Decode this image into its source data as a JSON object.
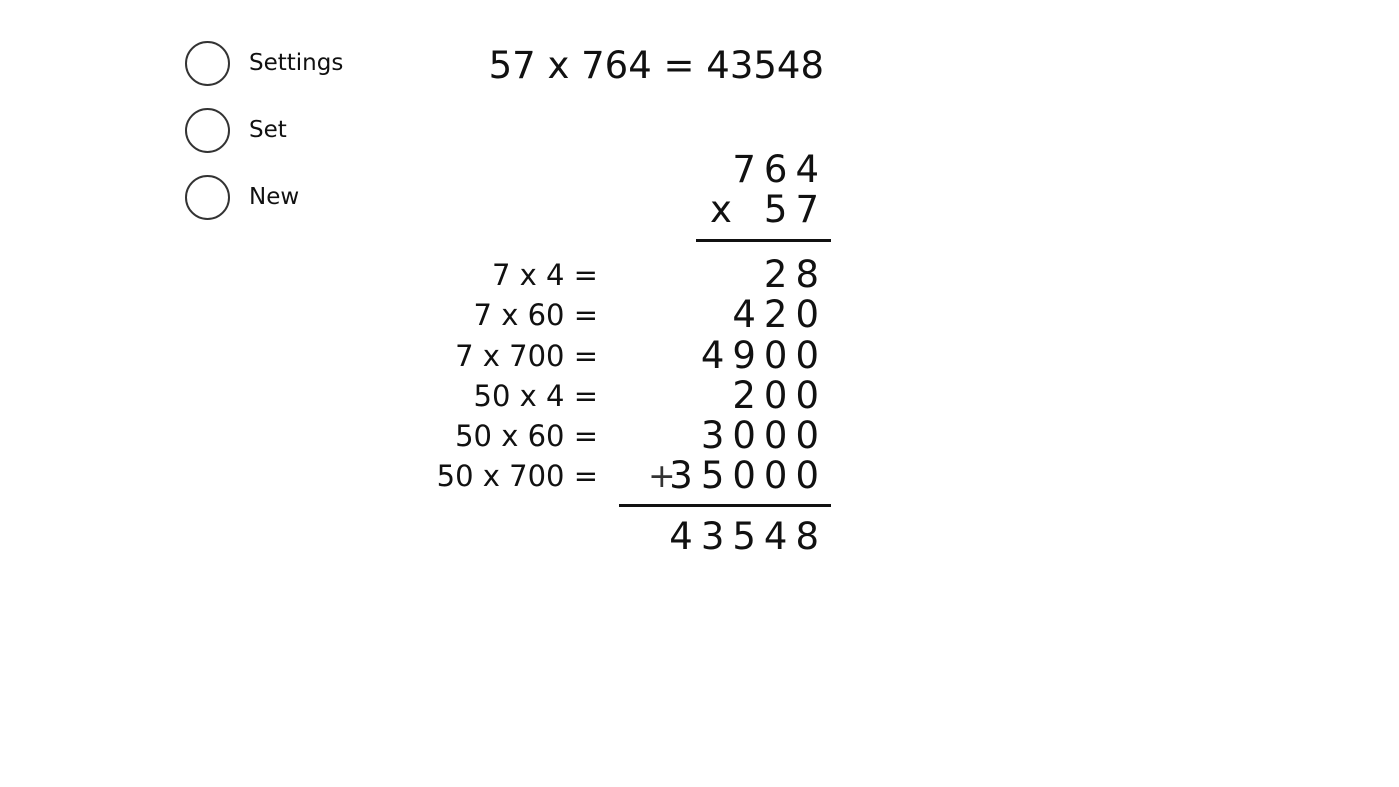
{
  "menu": {
    "items": [
      {
        "label": "Settings"
      },
      {
        "label": "Set"
      },
      {
        "label": "New"
      }
    ]
  },
  "equation": "57 x 764 = 43548",
  "multiplication": {
    "multiplicand": "764",
    "operator": "x",
    "multiplier": "57",
    "plus_sign": "+",
    "steps": [
      {
        "label": "7 x 4 =",
        "value": "28"
      },
      {
        "label": "7 x 60 =",
        "value": "420"
      },
      {
        "label": "7 x 700 =",
        "value": "4900"
      },
      {
        "label": "50 x 4 =",
        "value": "200"
      },
      {
        "label": "50 x 60 =",
        "value": "3000"
      },
      {
        "label": "50 x 700 =",
        "value": "35000"
      }
    ],
    "result": "43548"
  }
}
